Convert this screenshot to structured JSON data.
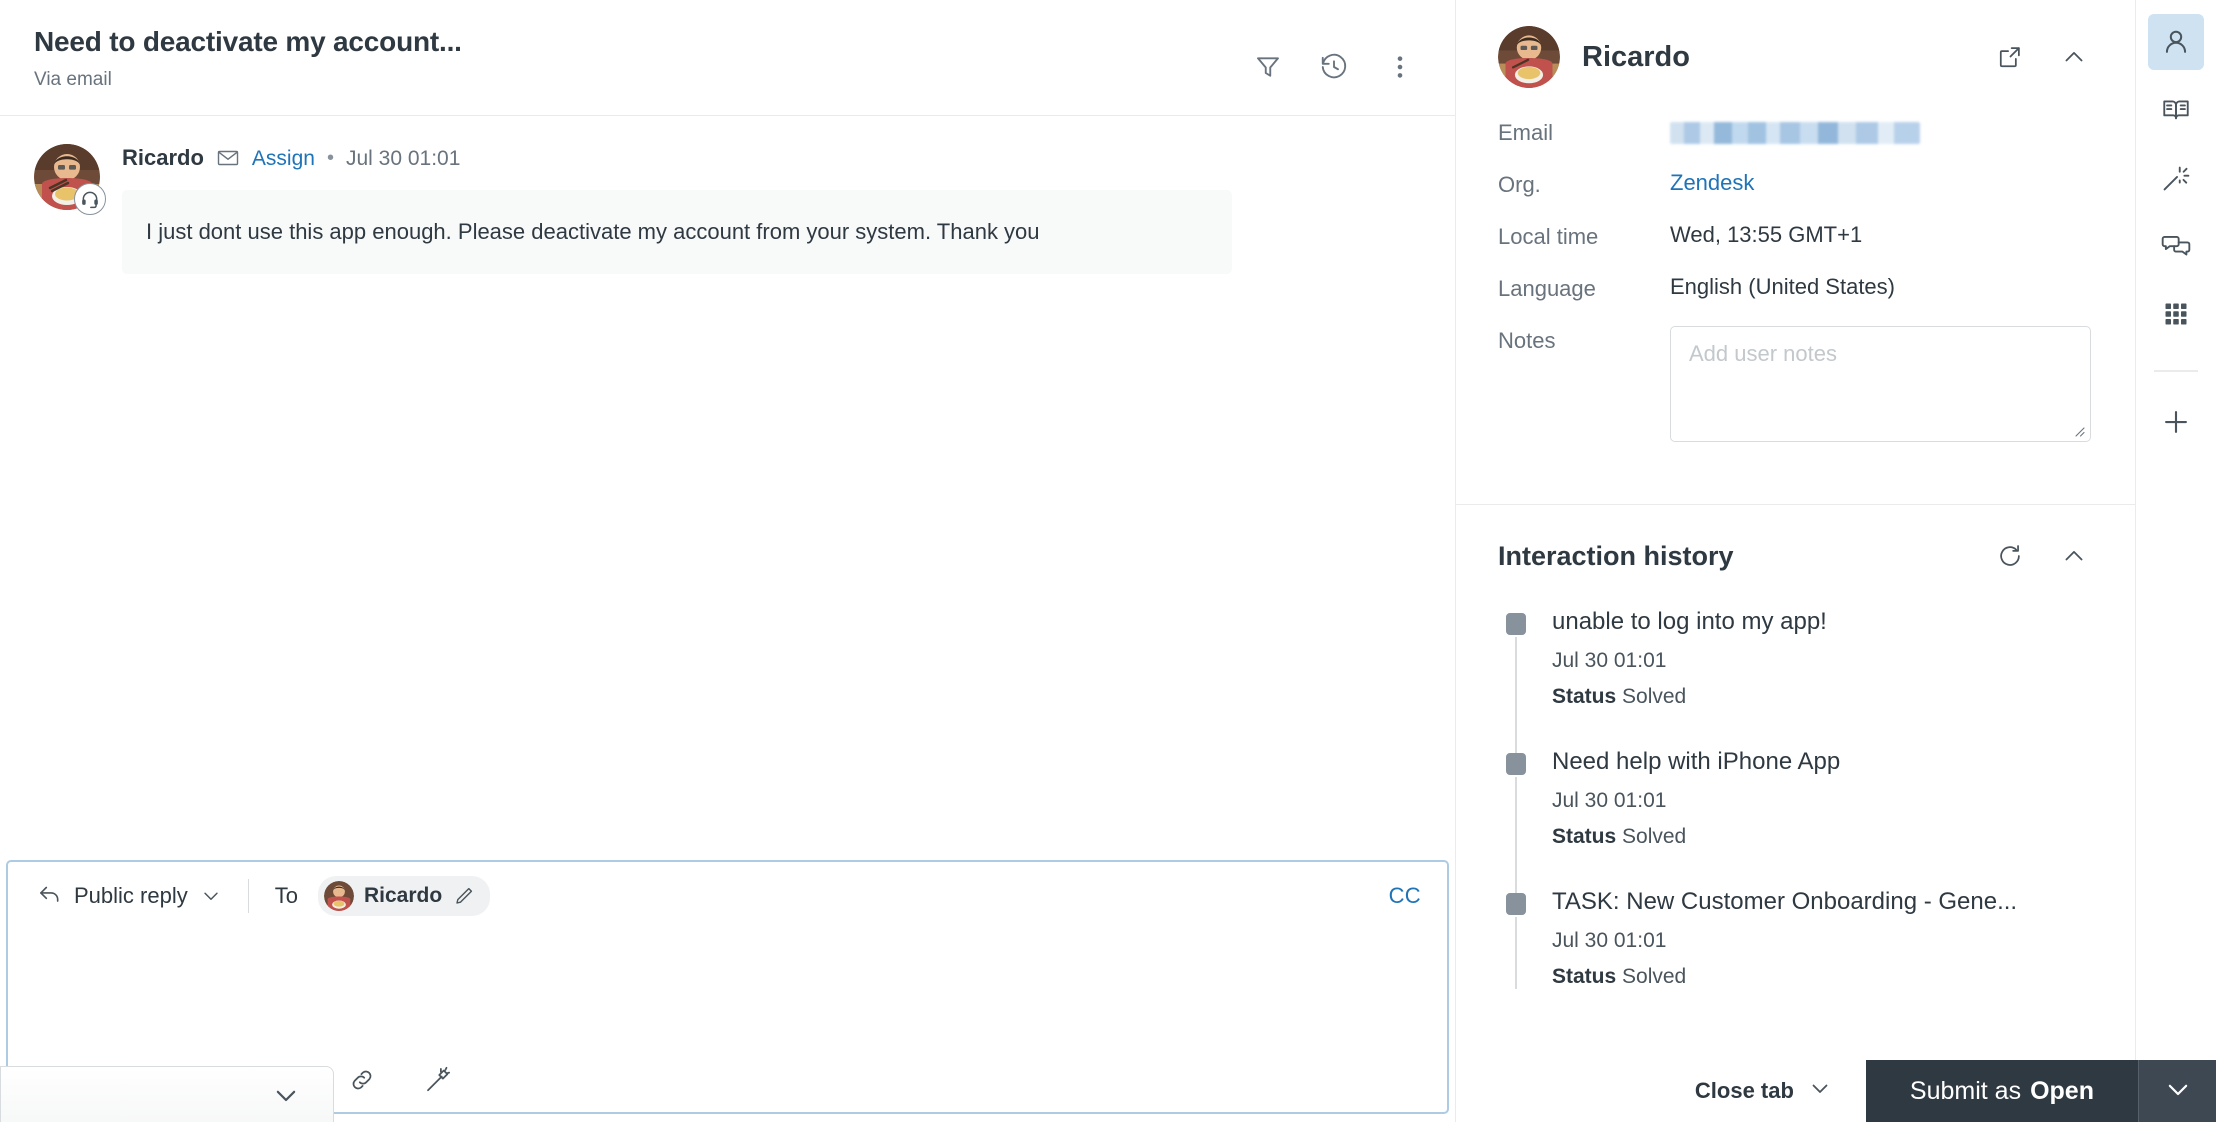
{
  "ticket": {
    "title": "Need to deactivate my account...",
    "via": "Via email",
    "header_icons": {
      "filter": "filter-icon",
      "history": "history-icon",
      "more": "more-vertical-icon"
    }
  },
  "comment": {
    "author": "Ricardo",
    "channel_icon": "envelope-icon",
    "assign_label": "Assign",
    "separator": "•",
    "timestamp": "Jul 30 01:01",
    "message": "I just dont use this app enough. Please deactivate my account from your system. Thank you"
  },
  "composer": {
    "reply_type": "Public reply",
    "to_label": "To",
    "recipient": "Ricardo",
    "cc_label": "CC",
    "body_value": "",
    "body_placeholder": "",
    "tools": [
      "macro-icon",
      "text-format-icon",
      "emoji-icon",
      "attachment-icon",
      "link-icon",
      "ai-wand-icon"
    ]
  },
  "user_panel": {
    "name": "Ricardo",
    "open_in_new_icon": "external-link-icon",
    "collapse_icon": "chevron-up-icon",
    "fields": [
      {
        "label": "Email",
        "value": "",
        "redacted": true
      },
      {
        "label": "Org.",
        "value": "Zendesk",
        "link": true
      },
      {
        "label": "Local time",
        "value": "Wed, 13:55 GMT+1"
      },
      {
        "label": "Language",
        "value": "English (United States)"
      }
    ],
    "notes": {
      "label": "Notes",
      "value": "",
      "placeholder": "Add user notes"
    }
  },
  "interaction_history": {
    "title": "Interaction history",
    "refresh_icon": "refresh-icon",
    "collapse_icon": "chevron-up-icon",
    "status_label": "Status",
    "items": [
      {
        "title": "unable to log into my app!",
        "date": "Jul 30 01:01",
        "status": "Solved"
      },
      {
        "title": "Need help with iPhone App",
        "date": "Jul 30 01:01",
        "status": "Solved"
      },
      {
        "title": "TASK: New Customer Onboarding - Gene...",
        "date": "Jul 30 01:01",
        "status": "Solved"
      }
    ]
  },
  "rail": {
    "items": [
      {
        "icon": "user-icon",
        "active": true
      },
      {
        "icon": "knowledge-book-icon",
        "active": false
      },
      {
        "icon": "magic-wand-icon",
        "active": false
      },
      {
        "icon": "conversations-icon",
        "active": false
      },
      {
        "icon": "apps-grid-icon",
        "active": false
      }
    ],
    "add_icon": "plus-icon"
  },
  "bottom_bar": {
    "close_tab": "Close tab",
    "submit_prefix": "Submit as",
    "submit_state": "Open",
    "submit_caret_icon": "chevron-down-icon"
  },
  "colors": {
    "accent_link": "#1f73b7",
    "text_primary": "#2f3941",
    "text_secondary": "#68737d",
    "submit_bg": "#2f3941",
    "focus_border": "#adcce4",
    "bubble_bg": "#f8f9f9",
    "rail_active_bg": "#cee2f2"
  }
}
